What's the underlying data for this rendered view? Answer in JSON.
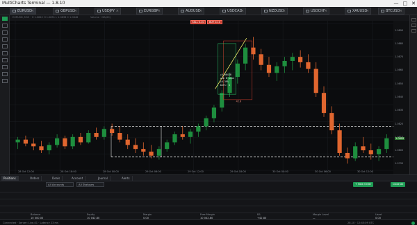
{
  "window": {
    "title": "MultiCharts Terminal — 1.8.10",
    "controls": [
      "—",
      "□",
      "✕"
    ]
  },
  "tabs": [
    {
      "label": "EURUSD"
    },
    {
      "label": "GBPUSD"
    },
    {
      "label": "USDJPY"
    },
    {
      "label": "EURGBP"
    },
    {
      "label": "AUDUSD"
    },
    {
      "label": "USDCAD"
    },
    {
      "label": "NZDUSD"
    },
    {
      "label": "USDCHF"
    },
    {
      "label": "XAUUSD"
    },
    {
      "label": "BTCUSD"
    }
  ],
  "chart_header": "EURUSD, M15 · O 1.0842 H 1.0851 L 1.0838 C 1.0846",
  "chart_subheader": "Volume · MA(20)",
  "order_badges": [
    "SELL 0.10",
    "BUY 0.10"
  ],
  "measure_box": {
    "lines": [
      "+0.00428",
      "+42.8 pips",
      "+0.39%",
      "bars: 4"
    ],
    "footnote": "42.8"
  },
  "chart_data": {
    "type": "candlestick",
    "colors": {
      "bull": "#1e8e3e",
      "bear": "#e0662f",
      "background": "#0b0c0e",
      "grid": "#1c1e22"
    },
    "candles": [
      [
        1.0806,
        1.081,
        1.0801,
        1.0808
      ],
      [
        1.0808,
        1.0811,
        1.0803,
        1.0805
      ],
      [
        1.0805,
        1.0809,
        1.08,
        1.0803
      ],
      [
        1.0803,
        1.0807,
        1.0798,
        1.08
      ],
      [
        1.08,
        1.0806,
        1.0797,
        1.0804
      ],
      [
        1.0804,
        1.0812,
        1.0802,
        1.0809
      ],
      [
        1.0809,
        1.0811,
        1.0801,
        1.0803
      ],
      [
        1.0803,
        1.0812,
        1.0801,
        1.081
      ],
      [
        1.081,
        1.0813,
        1.0804,
        1.0806
      ],
      [
        1.0806,
        1.0815,
        1.0805,
        1.0813
      ],
      [
        1.0813,
        1.0817,
        1.0808,
        1.081
      ],
      [
        1.081,
        1.0818,
        1.0808,
        1.0816
      ],
      [
        1.0816,
        1.082,
        1.0811,
        1.0813
      ],
      [
        1.0813,
        1.0818,
        1.0806,
        1.0808
      ],
      [
        1.0808,
        1.0812,
        1.0801,
        1.0804
      ],
      [
        1.0804,
        1.0809,
        1.0798,
        1.0801
      ],
      [
        1.0801,
        1.0806,
        1.0796,
        1.0799
      ],
      [
        1.0799,
        1.0804,
        1.0794,
        1.0796
      ],
      [
        1.0796,
        1.0803,
        1.0793,
        1.0801
      ],
      [
        1.0801,
        1.0808,
        1.0799,
        1.0806
      ],
      [
        1.0806,
        1.0814,
        1.0804,
        1.0812
      ],
      [
        1.0812,
        1.0818,
        1.0808,
        1.081
      ],
      [
        1.081,
        1.0816,
        1.0805,
        1.0814
      ],
      [
        1.0814,
        1.082,
        1.081,
        1.0818
      ],
      [
        1.0818,
        1.0826,
        1.0815,
        1.0824
      ],
      [
        1.0824,
        1.0834,
        1.0821,
        1.0832
      ],
      [
        1.0832,
        1.0845,
        1.0829,
        1.0843
      ],
      [
        1.0843,
        1.0858,
        1.084,
        1.0855
      ],
      [
        1.0855,
        1.0868,
        1.085,
        1.0865
      ],
      [
        1.0865,
        1.088,
        1.086,
        1.0877
      ],
      [
        1.0877,
        1.0885,
        1.0868,
        1.0872
      ],
      [
        1.0872,
        1.0876,
        1.086,
        1.0864
      ],
      [
        1.0864,
        1.087,
        1.0855,
        1.0858
      ],
      [
        1.0858,
        1.0866,
        1.0852,
        1.0863
      ],
      [
        1.0863,
        1.087,
        1.0858,
        1.0867
      ],
      [
        1.0867,
        1.0873,
        1.086,
        1.087
      ],
      [
        1.087,
        1.0875,
        1.0862,
        1.0866
      ],
      [
        1.0866,
        1.0872,
        1.0858,
        1.0861
      ],
      [
        1.0861,
        1.0866,
        1.084,
        1.0843
      ],
      [
        1.0843,
        1.0848,
        1.0825,
        1.0828
      ],
      [
        1.0828,
        1.0833,
        1.0812,
        1.0815
      ],
      [
        1.0815,
        1.082,
        1.0796,
        1.0798
      ],
      [
        1.0798,
        1.0802,
        1.079,
        1.0794
      ],
      [
        1.0794,
        1.0806,
        1.0792,
        1.0803
      ],
      [
        1.0803,
        1.081,
        1.0798,
        1.08
      ],
      [
        1.08,
        1.0805,
        1.0793,
        1.0797
      ],
      [
        1.0797,
        1.0803,
        1.0792,
        1.0801
      ],
      [
        1.0801,
        1.0812,
        1.0798,
        1.0809
      ]
    ],
    "hlines": [
      1.0818,
      1.0795
    ],
    "price_ticks": [
      "1.0890",
      "1.0880",
      "1.0870",
      "1.0860",
      "1.0850",
      "1.0840",
      "1.0830",
      "1.0820",
      "1.0810",
      "1.0800",
      "1.0790"
    ],
    "current_price": "1.0809",
    "time_ticks": [
      "28 Oct 12:00",
      "28 Oct 18:00",
      "29 Oct 00:00",
      "29 Oct 06:00",
      "29 Oct 12:00",
      "29 Oct 18:00",
      "30 Oct 00:00",
      "30 Oct 06:00",
      "30 Oct 12:00"
    ],
    "ylim": [
      1.0785,
      1.0895
    ]
  },
  "bottom_panel": {
    "tabs": [
      "Positions",
      "Orders",
      "Deals",
      "Account",
      "Journal",
      "Alerts"
    ],
    "filter": {
      "account": "All Accounts",
      "status": "All Statuses"
    },
    "buttons": {
      "new": "+ New Order",
      "close_all": "Close All"
    },
    "columns": [
      "Balance",
      "Equity",
      "Margin",
      "Free Margin",
      "P/L",
      "Margin Level",
      "Used"
    ],
    "values": [
      "10 000.00",
      "10 042.80",
      "0.00",
      "10 042.80",
      "+42.80",
      "—",
      "0.00"
    ]
  },
  "status": {
    "left": "Connected · Server: Live-01 · Latency 23 ms",
    "right": "28.10 · 12:45:09 UTC"
  }
}
